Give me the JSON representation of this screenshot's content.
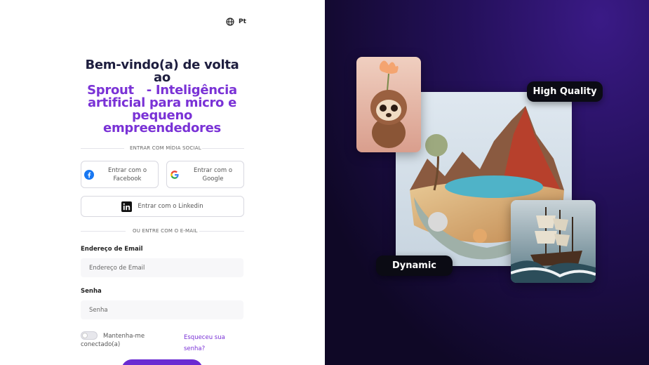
{
  "language": {
    "label": "Pt",
    "icon": "globe-icon"
  },
  "heading": {
    "line1": "Bem-vindo(a) de volta ao",
    "line2": "Sprout   - Inteligência",
    "line3": "artificial para micro e",
    "line4": "pequeno empreendedores"
  },
  "social": {
    "divider_label": "ENTRAR COM MÍDIA SOCIAL",
    "facebook_label": "Entrar com o Facebook",
    "google_label": "Entrar com o Google",
    "linkedin_label": "Entrar com o Linkedin"
  },
  "email_divider_label": "OU ENTRE COM O E-MAIL",
  "form": {
    "email_label": "Endereço de Email",
    "email_placeholder": "Endereço de Email",
    "email_value": "",
    "password_label": "Senha",
    "password_placeholder": "Senha",
    "password_value": "",
    "remember_label": "Mantenha-me conectado(a)",
    "remember_checked": false,
    "forgot_label": "Esqueceu sua senha?"
  },
  "showcase": {
    "badge_high_quality": "High Quality",
    "badge_dynamic": "Dynamic"
  },
  "colors": {
    "accent": "#7a32d6",
    "heading_dark": "#1e1e3f",
    "panel_bg": "#24105a"
  }
}
